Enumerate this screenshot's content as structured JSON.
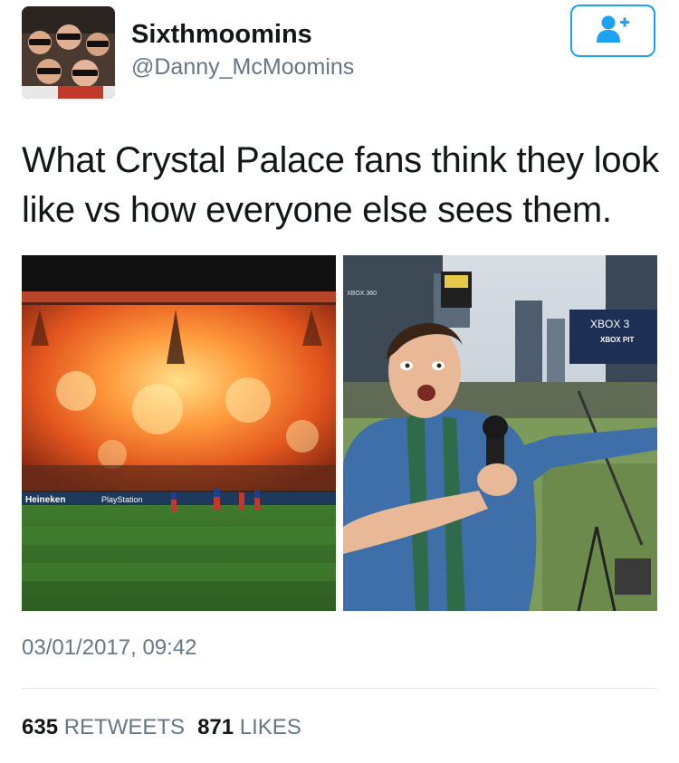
{
  "user": {
    "display_name": "Sixthmoomins",
    "handle": "@Danny_McMoomins"
  },
  "follow_button": {
    "icon": "add-user-icon",
    "color": "#1da1f2"
  },
  "tweet": {
    "text": "What Crystal Palace fans think they look like vs how everyone else sees them."
  },
  "photos": {
    "left": {
      "banner_text": "Heineken",
      "sponsor_text": "PlayStation"
    },
    "right": {
      "board_text": "XBOX 3",
      "board_sub": "XBOX PIT",
      "top_sign": "XBOX 360"
    }
  },
  "meta": {
    "timestamp": "03/01/2017, 09:42",
    "retweets_count": "635",
    "retweets_label": "RETWEETS",
    "likes_count": "871",
    "likes_label": "LIKES"
  },
  "colors": {
    "accent": "#1da1f2",
    "secondary_text": "#657786",
    "primary_text": "#14171a"
  }
}
